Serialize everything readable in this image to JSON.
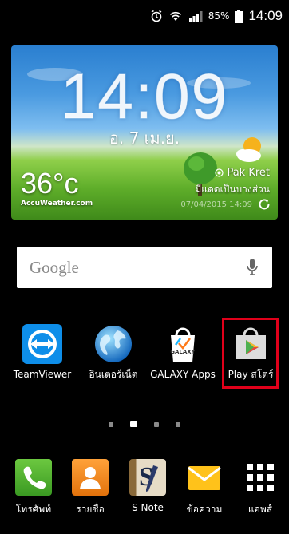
{
  "status_bar": {
    "alarm_icon": "alarm-clock-icon",
    "wifi_icon": "wifi-icon",
    "signal_icon": "signal-icon",
    "battery_percent": "85%",
    "time": "14:09"
  },
  "clock_widget": {
    "time": "14:09",
    "date": "อ. 7 เม.ย.",
    "temperature": "36°c",
    "provider": "AccuWeather.com",
    "location": "Pak Kret",
    "condition": "มีแดดเป็นบางส่วน",
    "updated": "07/04/2015 14:09"
  },
  "search": {
    "placeholder": "Google",
    "mic_icon": "microphone-icon"
  },
  "apps": [
    {
      "label": "TeamViewer",
      "icon": "teamviewer-icon"
    },
    {
      "label": "อินเตอร์เน็ต",
      "icon": "globe-icon"
    },
    {
      "label": "GALAXY Apps",
      "icon": "galaxy-apps-icon",
      "icon_text": "GALAXY"
    },
    {
      "label": "Play สโตร์",
      "icon": "play-store-icon"
    }
  ],
  "page_indicator": {
    "count": 4,
    "active": 1
  },
  "dock": [
    {
      "label": "โทรศัพท์",
      "icon": "phone-icon"
    },
    {
      "label": "รายชื่อ",
      "icon": "contacts-icon"
    },
    {
      "label": "S Note",
      "icon": "s-note-icon",
      "icon_text": "S"
    },
    {
      "label": "ข้อความ",
      "icon": "messages-icon"
    },
    {
      "label": "แอพส์",
      "icon": "apps-grid-icon"
    }
  ],
  "colors": {
    "highlight": "#e0001a",
    "teamviewer": "#0e8ee9",
    "phone": "#4caf2e",
    "contacts": "#f08a1c"
  }
}
